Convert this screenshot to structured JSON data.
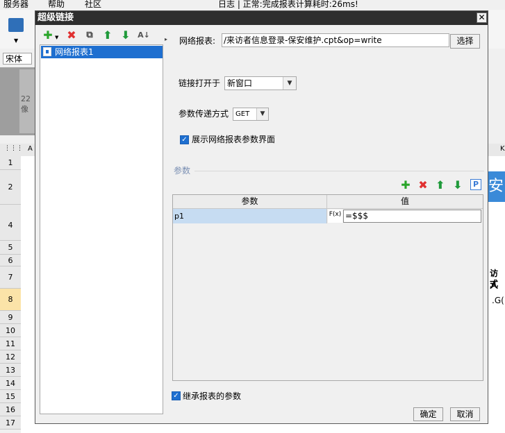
{
  "app": {
    "menu": [
      "服务器",
      "帮助",
      "社区"
    ],
    "status_text": "日志 | 正常:完成报表计算耗时:26ms!",
    "font_name": "宋体",
    "ruler_label": "22像",
    "column_header_a": "A",
    "column_header_k": "K",
    "rows": [
      "1",
      "2",
      "4",
      "5",
      "6",
      "7",
      "8",
      "9",
      "10",
      "11",
      "12",
      "13",
      "14",
      "15",
      "16",
      "17"
    ],
    "right_cell_texts": [
      "安",
      "访人",
      "式",
      ".G("
    ]
  },
  "dialog": {
    "title": "超级链接",
    "close_glyph": "✕",
    "tree": {
      "items": [
        {
          "label": "网络报表1"
        }
      ]
    },
    "form": {
      "report_label": "网络报表:",
      "report_value": "/来访者信息登录-保安维护.cpt&op=write",
      "choose_button": "选择",
      "open_in_label": "链接打开于",
      "open_in_value": "新窗口",
      "method_label": "参数传递方式",
      "method_value": "GET",
      "show_params_label": "展示网络报表参数界面",
      "show_params_checked": true
    },
    "params": {
      "legend": "参数",
      "columns": [
        "参数",
        "值"
      ],
      "rows": [
        {
          "name": "p1",
          "fx": "F(x)",
          "value": "=$$$"
        }
      ]
    },
    "inherit_label": "继承报表的参数",
    "inherit_checked": true,
    "ok_button": "确定",
    "cancel_button": "取消"
  },
  "icons": {
    "add": "plus-icon",
    "delete": "delete-icon",
    "copy": "copy-icon",
    "up": "arrow-up-icon",
    "down": "arrow-down-icon",
    "sort": "sort-az-icon",
    "param": "parameter-p-icon"
  },
  "colors": {
    "titlebar": "#2e2e2e",
    "selection": "#1e6fd0",
    "add_green": "#2aa52a",
    "delete_red": "#e03030",
    "arrow_green": "#1f9a3a",
    "row_highlight": "#c6dcf2"
  }
}
